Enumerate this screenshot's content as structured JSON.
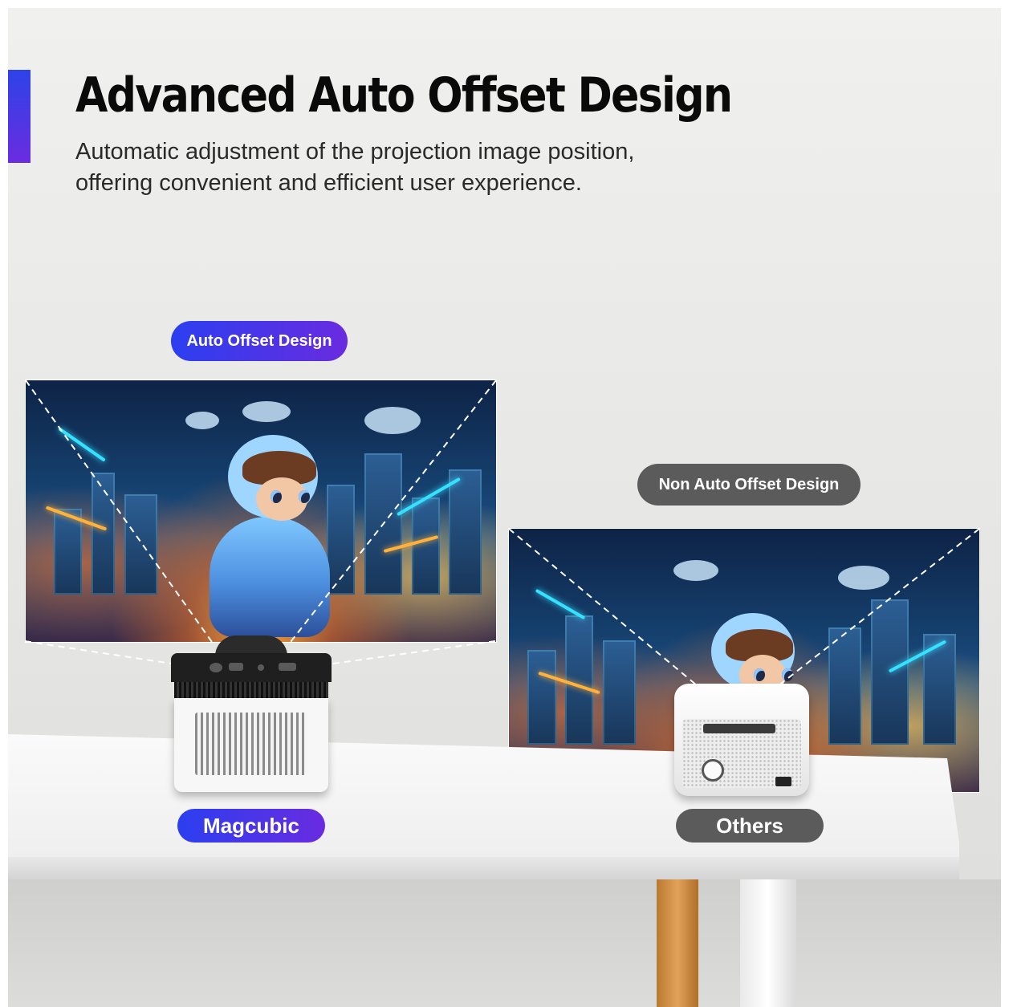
{
  "header": {
    "title": "Advanced Auto Offset Design",
    "subtitle_line1": "Automatic adjustment of the projection image position,",
    "subtitle_line2": "offering convenient and efficient user experience."
  },
  "left_product": {
    "feature_label": "Auto Offset Design",
    "brand_label": "Magcubic"
  },
  "right_product": {
    "feature_label": "Non Auto Offset Design",
    "brand_label": "Others"
  },
  "colors": {
    "accent_start": "#2b3ff0",
    "accent_end": "#6a2be0",
    "gray_pill": "#5b5b5b",
    "title_text": "#0a0a0a"
  }
}
